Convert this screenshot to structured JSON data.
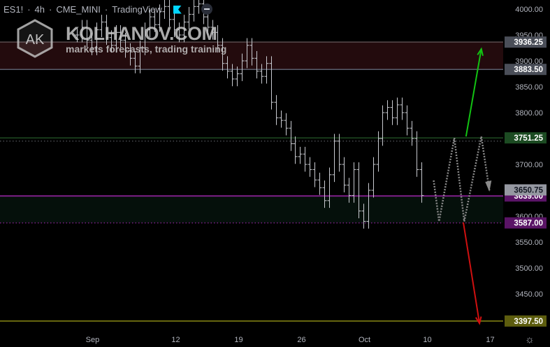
{
  "header": {
    "symbol": "ES1!",
    "interval": "4h",
    "exchange": "CME_MINI",
    "source": "TradingView"
  },
  "watermark": {
    "logo_text": "AK",
    "title": "KOLHANOV.COM",
    "subtitle": "markets forecasts, trading training"
  },
  "colors": {
    "bars": "#c8cad0",
    "accent_flag": "#00d5ff",
    "red_zone": "#230b0d",
    "green_zone": "#05100b",
    "up_arrow": "#12c312",
    "down_arrow": "#d01010",
    "purple": "#7b1f86",
    "olive": "#6a6a10"
  },
  "chart_data": {
    "type": "ohlc",
    "title": "ES1! · 4h · CME_MINI · TradingView",
    "x_unit": "days since Sep 1",
    "xlim": [
      -1,
      48.5
    ],
    "ylim": [
      3375.7,
      4017.6
    ],
    "y_scale": "price",
    "bars_start_day": 0,
    "bars_step_days": 0.54,
    "closes": [
      3950,
      3965,
      3940,
      3925,
      3960,
      3975,
      3945,
      3930,
      3955,
      3940,
      3920,
      3905,
      3890,
      3925,
      3960,
      3985,
      3970,
      3995,
      4005,
      3980,
      3960,
      3950,
      3975,
      3990,
      4005,
      4010,
      3985,
      3965,
      3955,
      3930,
      3895,
      3880,
      3865,
      3875,
      3900,
      3930,
      3905,
      3880,
      3870,
      3895,
      3820,
      3790,
      3785,
      3770,
      3740,
      3715,
      3720,
      3700,
      3690,
      3670,
      3655,
      3630,
      3680,
      3745,
      3700,
      3660,
      3640,
      3690,
      3610,
      3590,
      3650,
      3700,
      3750,
      3800,
      3810,
      3790,
      3815,
      3800,
      3770,
      3750,
      3690,
      3640
    ],
    "y_ticks": [
      4000,
      3950,
      3900,
      3850,
      3800,
      3750,
      3700,
      3650,
      3600,
      3550,
      3500,
      3450
    ],
    "x_ticks": [
      {
        "day": 0.5,
        "label": "Sep"
      },
      {
        "day": 11,
        "label": "12"
      },
      {
        "day": 18,
        "label": "19"
      },
      {
        "day": 25,
        "label": "26"
      },
      {
        "day": 32,
        "label": "Oct"
      },
      {
        "day": 39,
        "label": "10"
      },
      {
        "day": 46,
        "label": "17"
      }
    ],
    "zones": [
      {
        "name": "resistance-zone",
        "from": 3883.5,
        "to": 3936.25,
        "color": "#230b0d"
      },
      {
        "name": "support-zone",
        "from": 3587,
        "to": 3639,
        "color": "#05100b"
      }
    ],
    "levels": [
      {
        "name": "level-3936",
        "price": 3936.25,
        "label": "3936.25",
        "line": "#5a4a4c",
        "bg": "#4a4e58",
        "fg": "#ffffff"
      },
      {
        "name": "level-3883",
        "price": 3883.5,
        "label": "3883.50",
        "line": "#5a5e6c",
        "bg": "#4a4e58",
        "fg": "#ffffff"
      },
      {
        "name": "level-3751",
        "price": 3751.25,
        "label": "3751.25",
        "line": "#1f4a22",
        "bg": "#1c4b22",
        "fg": "#ffffff"
      },
      {
        "name": "level-3639",
        "price": 3639,
        "label": "3639.00",
        "line": "#7b1f86",
        "bg": "#5a1466",
        "fg": "#ffffff"
      },
      {
        "name": "last-price",
        "price": 3650.75,
        "label": "3650.75",
        "line": null,
        "bg": "#9598a1",
        "fg": "#131722"
      },
      {
        "name": "level-3587",
        "price": 3587,
        "label": "3587.00",
        "line": "#7b1f86",
        "dotted": true,
        "bg": "#5a1466",
        "fg": "#ffffff"
      },
      {
        "name": "level-3397",
        "price": 3397.5,
        "label": "3397.50",
        "line": "#6a6a10",
        "bg": "#5d5d0e",
        "fg": "#ffffff"
      }
    ],
    "dotted_level": 3745,
    "projection": [
      [
        39.7,
        3669
      ],
      [
        40.3,
        3590
      ],
      [
        42,
        3751
      ],
      [
        43.1,
        3590
      ],
      [
        45,
        3754
      ],
      [
        45.9,
        3650
      ]
    ],
    "up_arrow": [
      [
        43.3,
        3754
      ],
      [
        45,
        3923
      ]
    ],
    "down_arrow": [
      [
        43,
        3588
      ],
      [
        44.8,
        3393
      ]
    ]
  }
}
